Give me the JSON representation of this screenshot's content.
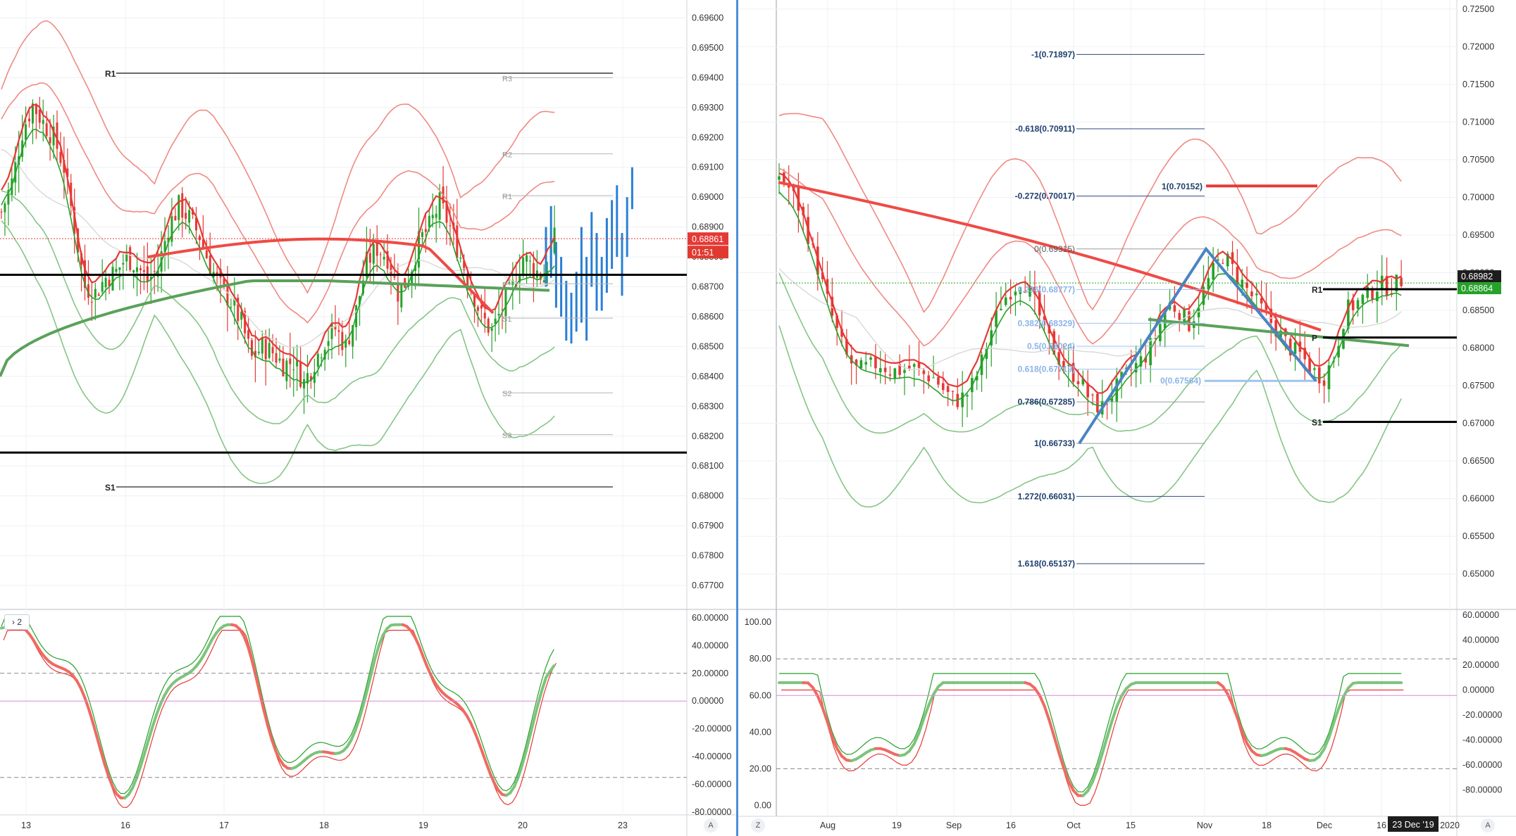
{
  "chart_data": [
    {
      "type": "candlestick",
      "panel": "left-main",
      "y_range": [
        0.6762,
        0.6966
      ],
      "x_ticks": [
        "13",
        "16",
        "17",
        "18",
        "19",
        "20",
        "23"
      ],
      "y_ticks": [
        "0.69600",
        "0.69500",
        "0.69400",
        "0.69300",
        "0.69200",
        "0.69100",
        "0.69000",
        "0.68900",
        "0.68800",
        "0.68700",
        "0.68600",
        "0.68500",
        "0.68400",
        "0.68300",
        "0.68200",
        "0.68100",
        "0.68000",
        "0.67900",
        "0.67800",
        "0.67700"
      ],
      "last_price": "0.68861",
      "countdown": "01:51",
      "pivot_levels": [
        {
          "label": "R1",
          "value": 0.69415
        },
        {
          "label": "S1",
          "value": 0.6803
        }
      ],
      "day_pivots": [
        {
          "label": "R3",
          "value": 0.694
        },
        {
          "label": "R2",
          "value": 0.69145
        },
        {
          "label": "R1",
          "value": 0.69005
        },
        {
          "label": "P",
          "value": 0.6871
        },
        {
          "label": "S1",
          "value": 0.68595
        },
        {
          "label": "S2",
          "value": 0.68345
        },
        {
          "label": "S3",
          "value": 0.68205
        }
      ],
      "horizontal_lines": [
        0.6874,
        0.68145
      ],
      "path": [
        0.6895,
        0.6905,
        0.6922,
        0.6931,
        0.6925,
        0.692,
        0.691,
        0.689,
        0.687,
        0.6868,
        0.6873,
        0.6875,
        0.688,
        0.6877,
        0.6872,
        0.6876,
        0.689,
        0.6897,
        0.6893,
        0.6887,
        0.6877,
        0.687,
        0.6865,
        0.6858,
        0.6846,
        0.685,
        0.6848,
        0.6844,
        0.6845,
        0.6838,
        0.6845,
        0.6852,
        0.6856,
        0.685,
        0.6862,
        0.6878,
        0.6883,
        0.688,
        0.6868,
        0.6873,
        0.6885,
        0.689,
        0.6898,
        0.689,
        0.688,
        0.687,
        0.686,
        0.6855,
        0.6863,
        0.687,
        0.688,
        0.6876,
        0.6873,
        0.6886
      ]
    },
    {
      "type": "line",
      "panel": "left-oscillator",
      "indicator_label": "2",
      "y_range": [
        -82,
        66
      ],
      "y_ticks": [
        "60.00000",
        "40.00000",
        "20.00000",
        "0.00000",
        "-20.00000",
        "-40.00000",
        "-60.00000",
        "-80.00000"
      ],
      "levels": [
        20,
        -55,
        0
      ]
    },
    {
      "type": "candlestick",
      "panel": "right-main",
      "y_range": [
        0.6453,
        0.7262
      ],
      "x_ticks": [
        "Aug",
        "19",
        "Sep",
        "16",
        "Oct",
        "15",
        "Nov",
        "18",
        "Dec",
        "16",
        "2020"
      ],
      "y_ticks": [
        "0.72500",
        "0.72000",
        "0.71500",
        "0.71000",
        "0.70500",
        "0.70000",
        "0.69500",
        "0.69000",
        "0.68500",
        "0.68000",
        "0.67500",
        "0.67000",
        "0.66500",
        "0.66000",
        "0.65500",
        "0.65000"
      ],
      "last_price": "0.68982",
      "last_price_2": "0.68864",
      "pivots": [
        {
          "label": "R1",
          "value": 0.6878
        },
        {
          "label": "P",
          "value": 0.6814
        },
        {
          "label": "S1",
          "value": 0.6702
        }
      ],
      "fib_top_label": "1(0.70152)",
      "fib_top_value": 0.70152,
      "fib_levels": [
        {
          "label": "-1(0.71897)",
          "value": 0.71897
        },
        {
          "label": "-0.618(0.70911)",
          "value": 0.70911
        },
        {
          "label": "-0.272(0.70017)",
          "value": 0.70017
        },
        {
          "label": "1.272(0.66031)",
          "value": 0.66031
        },
        {
          "label": "1.618(0.65137)",
          "value": 0.65137
        }
      ],
      "retracements": [
        {
          "label": "0(0.69315)",
          "value": 0.69315
        },
        {
          "label": "0.236(0.68777)",
          "value": 0.68777
        },
        {
          "label": "0.382(0.68329)",
          "value": 0.68329
        },
        {
          "label": "0.5(0.68024)",
          "value": 0.68024
        },
        {
          "label": "0.618(0.67719)",
          "value": 0.67719
        },
        {
          "label": "0.786(0.67285)",
          "value": 0.67285
        },
        {
          "label": "1(0.66733)",
          "value": 0.66733
        }
      ],
      "blue_retracement": {
        "label": "0(0.67564)",
        "value": 0.67564
      },
      "date_badge": "23 Dec '19",
      "path": [
        0.703,
        0.701,
        0.698,
        0.693,
        0.688,
        0.683,
        0.679,
        0.677,
        0.6775,
        0.678,
        0.677,
        0.677,
        0.6775,
        0.6765,
        0.676,
        0.674,
        0.673,
        0.674,
        0.677,
        0.682,
        0.686,
        0.688,
        0.689,
        0.686,
        0.682,
        0.679,
        0.677,
        0.676,
        0.673,
        0.672,
        0.674,
        0.676,
        0.6775,
        0.679,
        0.682,
        0.686,
        0.685,
        0.683,
        0.687,
        0.69,
        0.6925,
        0.69,
        0.688,
        0.686,
        0.684,
        0.682,
        0.68,
        0.679,
        0.677,
        0.676,
        0.679,
        0.685,
        0.686,
        0.687,
        0.6885,
        0.688,
        0.689
      ]
    },
    {
      "type": "line",
      "panel": "right-oscillator",
      "y_range_left": [
        -6,
        107
      ],
      "y_ticks_left": [
        "100.00",
        "80.00",
        "60.00",
        "40.00",
        "20.00",
        "0.00"
      ],
      "y_ticks_right": [
        "60.00000",
        "40.00000",
        "20.00000",
        "0.00000",
        "-20.00000",
        "-40.00000",
        "-60.00000",
        "-80.00000"
      ],
      "levels": [
        80,
        20,
        60
      ]
    }
  ],
  "ui": {
    "left_axis_corner": "A",
    "right_axis_corner": "A",
    "right_left_corner": "Z",
    "indicator_chevron": "›"
  },
  "colors": {
    "up": "#26a12a",
    "down": "#e53935",
    "ma_red": "#ee4b45",
    "ma_green": "#5aa15a",
    "band_red": "#f08a83",
    "band_green": "#86c586",
    "blue_bars": "#2a7fd4",
    "fib_blue": "#4a84c4",
    "separator": "#4f8fd6"
  }
}
